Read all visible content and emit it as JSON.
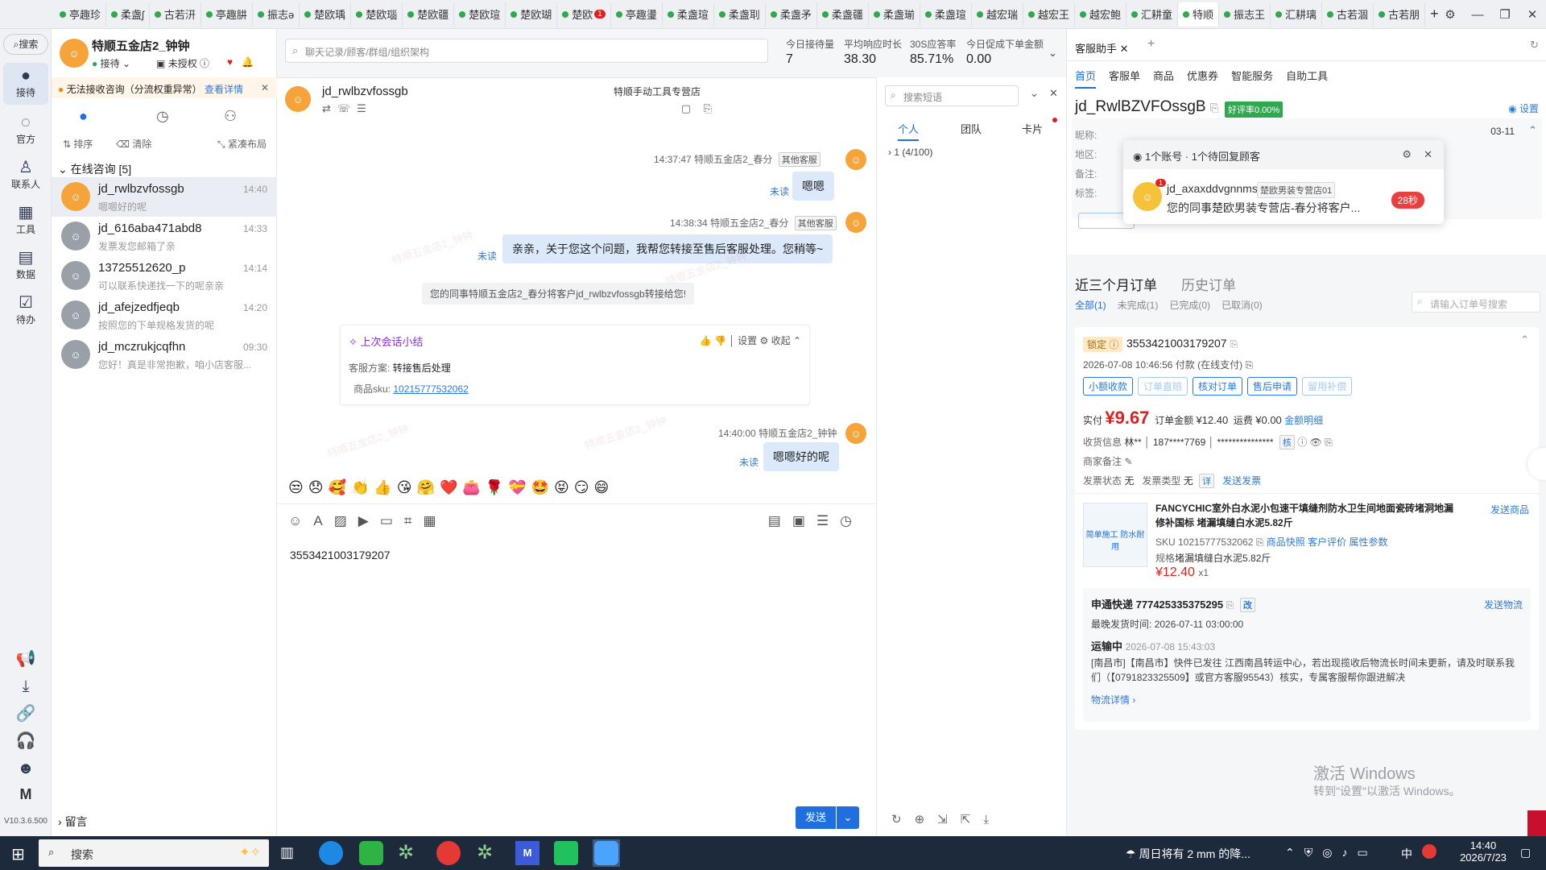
{
  "tabs": [
    {
      "label": "亭趣珍"
    },
    {
      "label": "柔盏ʃ"
    },
    {
      "label": "古若汧"
    },
    {
      "label": "亭趣肼"
    },
    {
      "label": "振志ə"
    },
    {
      "label": "楚欧瑀"
    },
    {
      "label": "楚欧瑙"
    },
    {
      "label": "楚欧疆"
    },
    {
      "label": "楚欧瑄"
    },
    {
      "label": "楚欧瑚"
    },
    {
      "label": "楚欧",
      "badge": "1"
    },
    {
      "label": "亭趣璗"
    },
    {
      "label": "柔盏瑄"
    },
    {
      "label": "柔盏刵"
    },
    {
      "label": "柔盏矛"
    },
    {
      "label": "柔盏疆"
    },
    {
      "label": "柔盏瑐"
    },
    {
      "label": "柔盏瑄"
    },
    {
      "label": "越宏瑞"
    },
    {
      "label": "越宏王"
    },
    {
      "label": "越宏鲍"
    },
    {
      "label": "汇耕童"
    },
    {
      "label": "特顺",
      "active": true
    },
    {
      "label": "振志王"
    },
    {
      "label": "汇耕璃"
    },
    {
      "label": "古若涸"
    },
    {
      "label": "古若朋"
    }
  ],
  "rail": {
    "search": "搜索",
    "items": [
      {
        "label": "接待",
        "icon": "chat-icon"
      },
      {
        "label": "官方",
        "icon": "message-icon"
      },
      {
        "label": "联系人",
        "icon": "contact-icon"
      },
      {
        "label": "工具",
        "icon": "grid-icon"
      },
      {
        "label": "数据",
        "icon": "chart-icon"
      },
      {
        "label": "待办",
        "icon": "todo-icon"
      }
    ],
    "version": "V10.3.6.500"
  },
  "left": {
    "shop_name": "特顺五金店2_钟钟",
    "status": "接待",
    "auth": "未授权",
    "warning": "无法接收咨询（分流权重异常）",
    "warning_link": "查看详情",
    "sort": "排序",
    "clear": "清除",
    "compact": "紧凑布局",
    "section": "在线咨询 [5]",
    "footer": "留言",
    "conversations": [
      {
        "name": "jd_rwlbzvfossgb",
        "time": "14:40",
        "preview": "嗯嗯好的呢"
      },
      {
        "name": "jd_616aba471abd8",
        "time": "14:33",
        "preview": "发票发您邮箱了亲"
      },
      {
        "name": "13725512620_p",
        "time": "14:14",
        "preview": "可以联系快递找一下的呢亲亲"
      },
      {
        "name": "jd_afejzedfjeqb",
        "time": "14:20",
        "preview": "按照您的下单规格发货的呢"
      },
      {
        "name": "jd_mczrukjcqfhn",
        "time": "09:30",
        "preview": "您好！真是非常抱歉，咱小店客服..."
      }
    ]
  },
  "top": {
    "search_placeholder": "聊天记录/顾客/群组/组织架构",
    "stats": [
      {
        "label": "今日接待量",
        "value": "7"
      },
      {
        "label": "平均响应时长",
        "value": "38.30"
      },
      {
        "label": "30S应答率",
        "value": "85.71%"
      },
      {
        "label": "今日促成下单金额",
        "value": "0.00"
      }
    ]
  },
  "chat": {
    "customer": "jd_rwlbzvfossgb",
    "shop_tag": "特顺手动工具专营店",
    "msg1": {
      "time": "14:37:47",
      "sender": "特顺五金店2_春分",
      "tag": "其他客服",
      "text": "嗯嗯",
      "status": "未读"
    },
    "msg2": {
      "time": "14:38:34",
      "sender": "特顺五金店2_春分",
      "tag": "其他客服",
      "text": "亲亲，关于您这个问题，我帮您转接至售后客服处理。您稍等~",
      "status": "未读"
    },
    "system": "您的同事特顺五金店2_春分将客户jd_rwlbzvfossgb转接给您!",
    "summary": {
      "title": "上次会话小结",
      "settings": "设置",
      "collapse": "收起",
      "plan_label": "客服方案:",
      "plan": "转接售后处理",
      "sku_label": "商品sku:",
      "sku": "10215777532062"
    },
    "msg3": {
      "time": "14:40:00",
      "sender": "特顺五金店2_钟钟",
      "text": "嗯嗯好的呢",
      "status": "未读"
    },
    "watermark": "特顺五金店2_钟钟",
    "input_text": "3553421003179207",
    "send": "发送"
  },
  "quick": {
    "search_placeholder": "搜索短语",
    "tabs": [
      "个人",
      "团队",
      "卡片"
    ],
    "group": "1 (4/100)"
  },
  "assist": {
    "title": "客服助手",
    "nav": [
      "首页",
      "客服单",
      "商品",
      "优惠券",
      "智能服务",
      "自助工具"
    ],
    "customer": "jd_RwlBZVFOssgB",
    "rating": "好评率0.00%",
    "settings": "设置",
    "info_labels": [
      "昵称:",
      "地区:",
      "备注:",
      "标签:"
    ],
    "date": "03-11",
    "popup": {
      "header": "1个账号 · 1个待回复顾客",
      "user": "jd_axaxddvgnnms",
      "store_tag": "楚欧男装专营店01",
      "text": "您的同事楚欧男装专营店-春分将客户...",
      "timer": "28秒",
      "badge": "1"
    },
    "orders_tab": "近三个月订单",
    "history_tab": "历史订单",
    "filters": [
      "全部(1)",
      "未完成(1)",
      "已完成(0)",
      "已取消(0)"
    ],
    "order_search": "请输入订单号搜索",
    "order": {
      "lock": "锁定",
      "id": "3553421003179207",
      "time": "2026-07-08 10:46:56 付款",
      "pay": "(在线支付)",
      "buttons": [
        "小额收款",
        "订单直赔",
        "核对订单",
        "售后申请",
        "留用补偿"
      ],
      "paid_label": "实付",
      "paid": "¥9.67",
      "amount_label": "订单金额",
      "amount": "¥12.40",
      "freight_label": "运费",
      "freight": "¥0.00",
      "detail": "金额明细",
      "recv_label": "收货信息",
      "recv_name": "林**",
      "recv_phone": "187****7769",
      "recv_addr": "***************",
      "recv_check": "核",
      "note_label": "商家备注",
      "invoice_status_label": "发票状态",
      "invoice_status": "无",
      "invoice_type_label": "发票类型",
      "invoice_type": "无",
      "invoice_detail": "详",
      "invoice_send": "发送发票"
    },
    "product": {
      "name": "FANCYCHIC室外白水泥小包速干填缝剂防水卫生间地面瓷砖堵洞地漏修补国标 堵漏填缝白水泥5.82斤",
      "sku": "SKU 10215777532062",
      "links": [
        "商品快照",
        "客户评价",
        "属性参数"
      ],
      "spec_label": "规格",
      "spec": "堵漏填缝白水泥5.82斤",
      "price": "¥12.40",
      "qty": "x1",
      "send": "发送商品",
      "thumb_text": "简单施工 防水耐用"
    },
    "logistics": {
      "company": "申通快递",
      "number": "777425335375295",
      "send": "发送物流",
      "ship_label": "最晚发货时间:",
      "ship_time": "2026-07-11 03:00:00",
      "status": "运输中",
      "status_time": "2026-07-08 15:43:03",
      "detail": "[南昌市]【南昌市】快件已发往 江西南昌转运中心，若出现揽收后物流长时间未更新，请及时联系我们（【0791823325509】或官方客服95543）核实，专属客服帮你跟进解决",
      "more": "物流详情"
    },
    "activate1": "激活 Windows",
    "activate2": "转到\"设置\"以激活 Windows。"
  },
  "taskbar": {
    "search": "搜索",
    "weather": "周日将有 2 mm 的降...",
    "time": "14:40",
    "date": "2026/7/23",
    "ime": "中"
  }
}
